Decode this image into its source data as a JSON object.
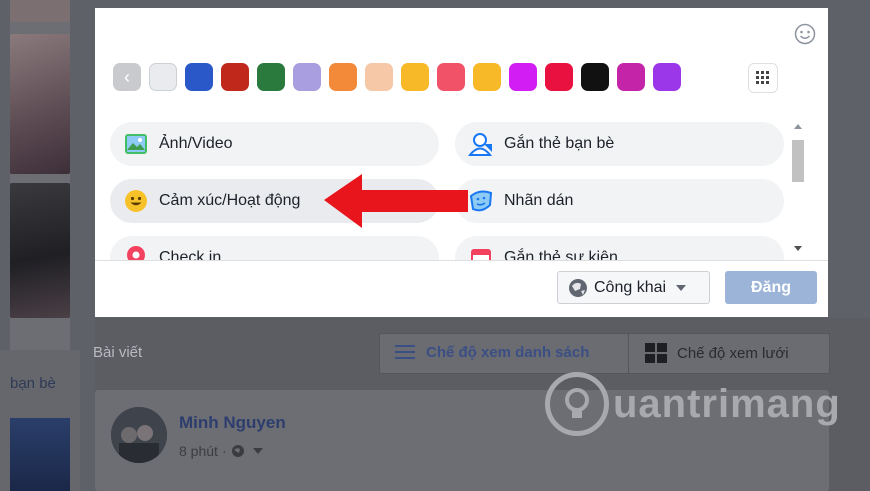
{
  "modal": {
    "options": [
      {
        "label": "Ảnh/Video",
        "icon": "photo-icon"
      },
      {
        "label": "Gắn thẻ bạn bè",
        "icon": "tag-friends-icon"
      },
      {
        "label": "Cảm xúc/Hoạt động",
        "icon": "feeling-icon"
      },
      {
        "label": "Nhãn dán",
        "icon": "sticker-icon"
      },
      {
        "label": "Check in",
        "icon": "checkin-icon"
      },
      {
        "label": "Gắn thẻ sự kiện",
        "icon": "event-icon"
      }
    ],
    "privacy_label": "Công khai",
    "post_label": "Đăng",
    "swatch_colors": [
      "#e9ebee",
      "#2b58c8",
      "#c0281c",
      "#2a7a3e",
      "#a89ee0",
      "#f28a3a",
      "#f6c8a8",
      "#f7b928",
      "#f25268",
      "#f7b928",
      "#d21ef4",
      "#e8113f",
      "#111111",
      "#c424a8",
      "#9b37e8"
    ],
    "accent_color": "#4267b2"
  },
  "background": {
    "posts_label": "Bài viết",
    "friends_label": "bạn bè",
    "list_view_label": "Chế độ xem danh sách",
    "grid_view_label": "Chế độ xem lưới",
    "post": {
      "author": "Minh Nguyen",
      "time": "8 phút"
    }
  },
  "watermark": {
    "text": "uantrimang"
  }
}
